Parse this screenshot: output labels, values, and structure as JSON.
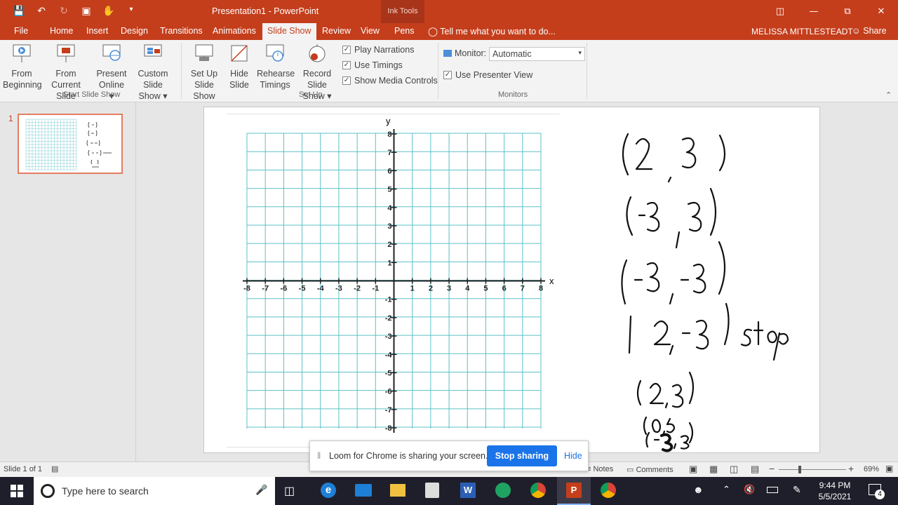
{
  "titlebar": {
    "title": "Presentation1 - PowerPoint",
    "context_tab": "Ink Tools",
    "qat_icons": [
      "save-icon",
      "undo-icon",
      "redo-icon",
      "present-icon",
      "touch-mode-icon",
      "customize-icon"
    ],
    "window_icons": [
      "ribbon-display-icon",
      "minimize-icon",
      "restore-icon",
      "close-icon"
    ]
  },
  "tabs": {
    "items": [
      "File",
      "Home",
      "Insert",
      "Design",
      "Transitions",
      "Animations",
      "Slide Show",
      "Review",
      "View",
      "Pens"
    ],
    "active": "Slide Show",
    "tell_me": "Tell me what you want to do...",
    "user": "MELISSA MITTLESTEADT",
    "share": "Share"
  },
  "ribbon": {
    "buttons": [
      {
        "line1": "From",
        "line2": "Beginning"
      },
      {
        "line1": "From",
        "line2": "Current Slide"
      },
      {
        "line1": "Present",
        "line2": "Online ▾"
      },
      {
        "line1": "Custom Slide",
        "line2": "Show ▾"
      },
      {
        "line1": "Set Up",
        "line2": "Slide Show"
      },
      {
        "line1": "Hide",
        "line2": "Slide"
      },
      {
        "line1": "Rehearse",
        "line2": "Timings"
      },
      {
        "line1": "Record Slide",
        "line2": "Show ▾"
      }
    ],
    "checkboxes": [
      {
        "label": "Play Narrations",
        "checked": true
      },
      {
        "label": "Use Timings",
        "checked": true
      },
      {
        "label": "Show Media Controls",
        "checked": true
      }
    ],
    "monitor_label": "Monitor:",
    "monitor_value": "Automatic",
    "presenter_view": "Use Presenter View",
    "groups": [
      "Start Slide Show",
      "Set Up",
      "Monitors"
    ]
  },
  "thumbnail": {
    "number": "1"
  },
  "slide": {
    "axis_x": "x",
    "axis_y": "y",
    "x_ticks": [
      "-8",
      "-7",
      "-6",
      "-5",
      "-4",
      "-3",
      "-2",
      "-1",
      "1",
      "2",
      "3",
      "4",
      "5",
      "6",
      "7",
      "8"
    ],
    "y_ticks": [
      "8",
      "7",
      "6",
      "5",
      "4",
      "3",
      "2",
      "1",
      "-1",
      "-2",
      "-3",
      "-4",
      "-5",
      "-6",
      "-7",
      "-8"
    ],
    "grid_color": "#5bc0c8",
    "handwriting": [
      "(2,3)",
      "(-3,3)",
      "(-3,-3)",
      "(2,-3) stop",
      "(2,3)",
      "(0,5)",
      "(-3,3)"
    ]
  },
  "status": {
    "slide_of": "Slide 1 of 1",
    "notes": "Notes",
    "comments": "Comments",
    "zoom": "69%"
  },
  "loom": {
    "message": "Loom for Chrome is sharing your screen.",
    "stop": "Stop sharing",
    "hide": "Hide"
  },
  "taskbar": {
    "search_placeholder": "Type here to search",
    "time": "9:44 PM",
    "date": "5/5/2021",
    "notification_count": "4"
  }
}
